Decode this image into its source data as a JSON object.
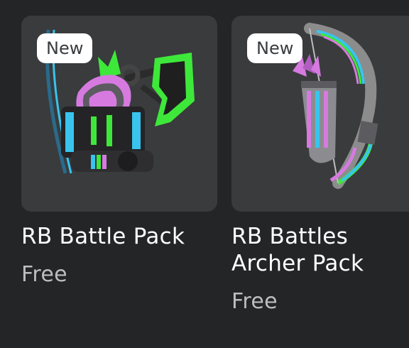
{
  "items": [
    {
      "badge": "New",
      "name": "RB Battle Pack",
      "price": "Free",
      "image_icon": "battle-pack-thumbnail"
    },
    {
      "badge": "New",
      "name": "RB Battles Archer Pack",
      "price": "Free",
      "image_icon": "archer-pack-thumbnail"
    }
  ],
  "colors": {
    "background": "#232527",
    "card": "#393b3d",
    "badge_bg": "#ffffff",
    "badge_text": "#393b3d",
    "name_text": "#ffffff",
    "price_text": "#bdbebe",
    "accent_green": "#3ee83a",
    "accent_pink": "#e07ee8",
    "accent_blue": "#38c4ee"
  }
}
